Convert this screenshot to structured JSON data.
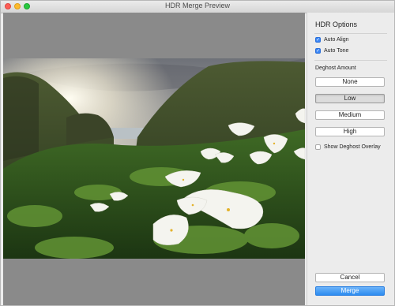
{
  "window": {
    "title": "HDR Merge Preview"
  },
  "sidebar": {
    "title": "HDR Options",
    "auto_align": {
      "label": "Auto Align",
      "checked": true
    },
    "auto_tone": {
      "label": "Auto Tone",
      "checked": true
    },
    "deghost": {
      "label": "Deghost Amount",
      "options": [
        "None",
        "Low",
        "Medium",
        "High"
      ],
      "selected": "Low"
    },
    "show_overlay": {
      "label": "Show Deghost Overlay",
      "checked": false
    }
  },
  "footer": {
    "cancel_label": "Cancel",
    "merge_label": "Merge"
  },
  "colors": {
    "accent": "#2d8cf0",
    "preview_bg": "#8a8a8a"
  }
}
